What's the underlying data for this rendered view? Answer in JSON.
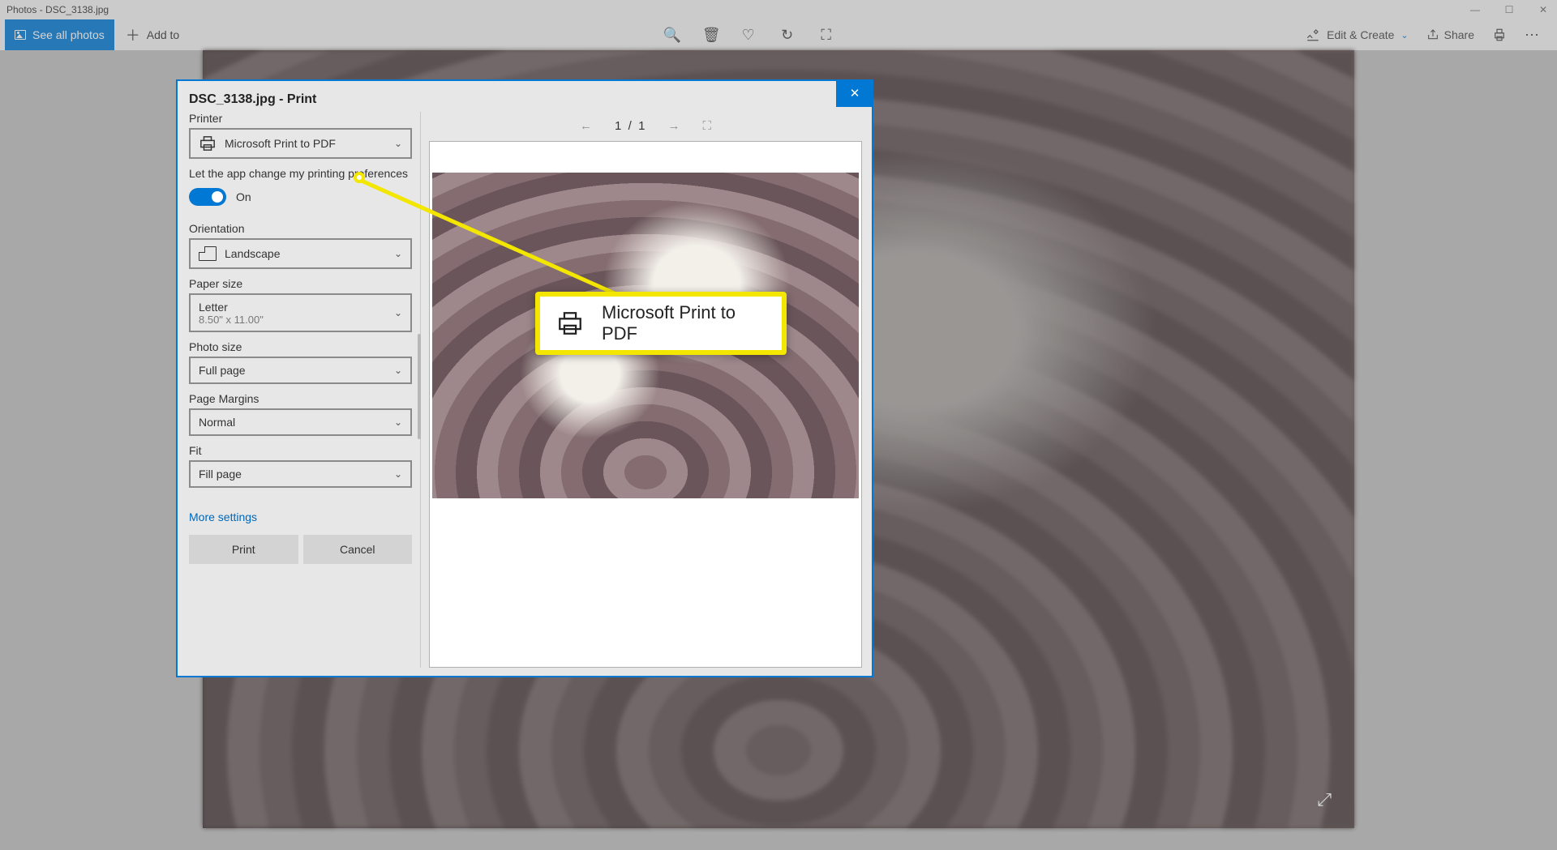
{
  "window": {
    "title": "Photos - DSC_3138.jpg"
  },
  "toolbar": {
    "see_all": "See all photos",
    "add_to": "Add to",
    "edit_create": "Edit & Create",
    "share": "Share"
  },
  "dialog": {
    "title": "DSC_3138.jpg - Print",
    "labels": {
      "printer": "Printer",
      "let_app": "Let the app change my printing preferences",
      "toggle_state": "On",
      "orientation": "Orientation",
      "paper_size": "Paper size",
      "photo_size": "Photo size",
      "page_margins": "Page Margins",
      "fit": "Fit"
    },
    "values": {
      "printer": "Microsoft Print to PDF",
      "orientation": "Landscape",
      "paper_size": "Letter",
      "paper_dim": "8.50\" x 11.00\"",
      "photo_size": "Full page",
      "page_margins": "Normal",
      "fit": "Fill page"
    },
    "more_settings": "More settings",
    "buttons": {
      "print": "Print",
      "cancel": "Cancel"
    },
    "preview": {
      "page": "1",
      "sep": "/",
      "total": "1"
    }
  },
  "callout": {
    "text": "Microsoft Print to PDF"
  }
}
